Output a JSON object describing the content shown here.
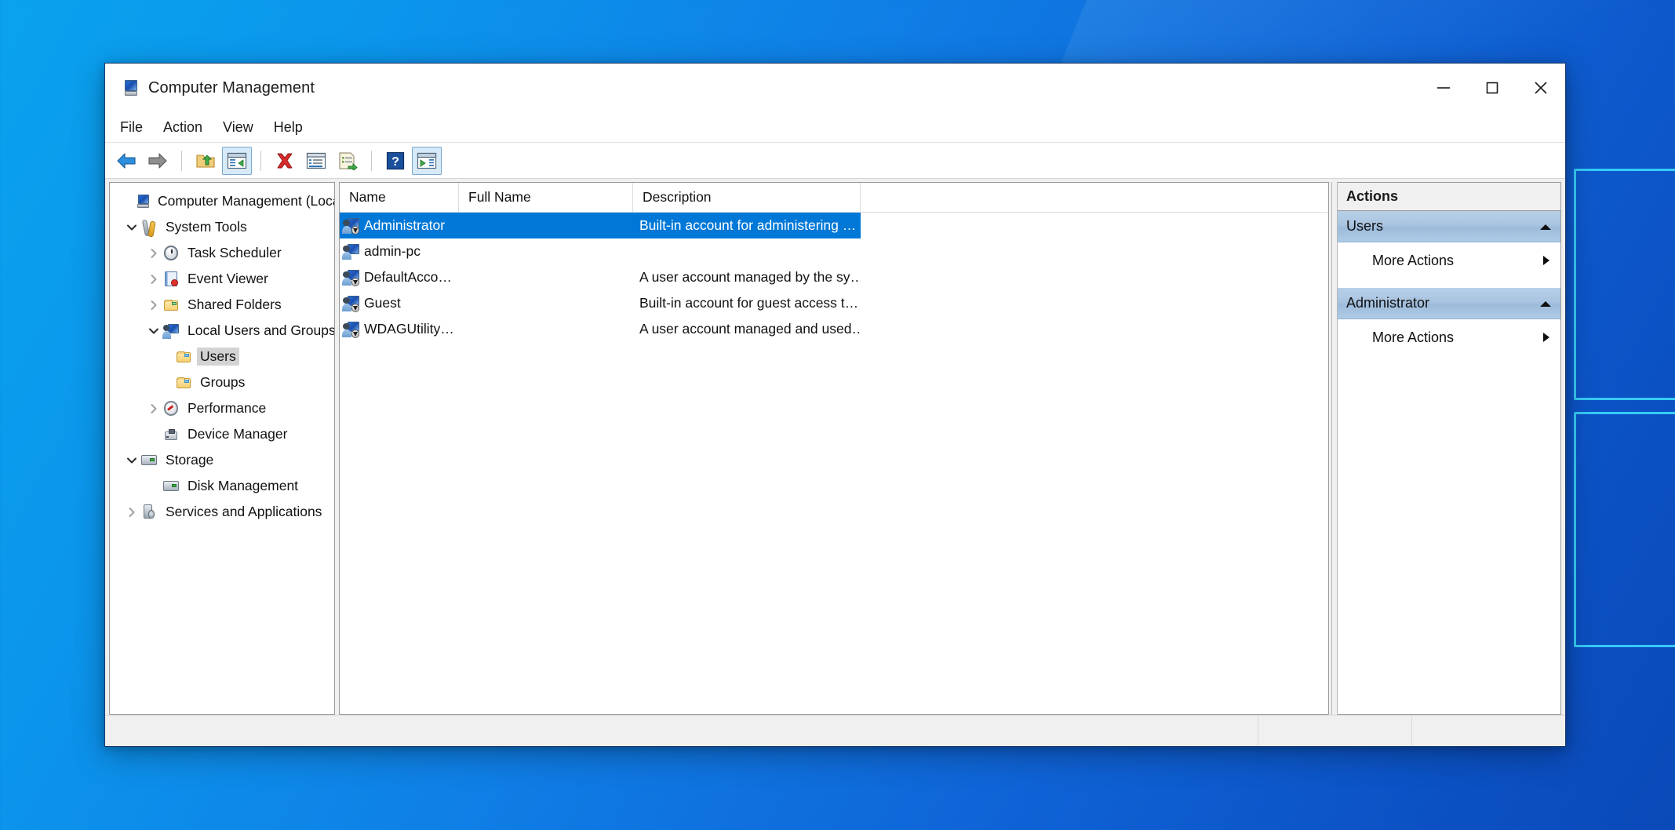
{
  "window": {
    "title": "Computer Management",
    "app_icon": "computer-management-icon",
    "controls": {
      "minimize": "minimize-icon",
      "maximize": "maximize-icon",
      "close": "close-icon"
    }
  },
  "menubar": {
    "items": [
      {
        "label": "File",
        "name": "menu-file"
      },
      {
        "label": "Action",
        "name": "menu-action"
      },
      {
        "label": "View",
        "name": "menu-view"
      },
      {
        "label": "Help",
        "name": "menu-help"
      }
    ]
  },
  "toolbar": {
    "buttons": [
      {
        "name": "back-button",
        "icon": "back-arrow-icon",
        "active": false
      },
      {
        "name": "forward-button",
        "icon": "forward-arrow-icon",
        "active": false
      },
      {
        "name": "up-one-level-button",
        "icon": "folder-up-icon",
        "active": false
      },
      {
        "name": "show-hide-console-tree-button",
        "icon": "console-tree-icon",
        "active": true
      },
      {
        "name": "delete-button",
        "icon": "delete-x-icon",
        "active": false
      },
      {
        "name": "properties-button",
        "icon": "properties-icon",
        "active": false
      },
      {
        "name": "export-list-button",
        "icon": "export-list-icon",
        "active": false
      },
      {
        "name": "help-button",
        "icon": "help-question-icon",
        "active": false
      },
      {
        "name": "show-hide-action-pane-button",
        "icon": "action-pane-icon",
        "active": true
      }
    ]
  },
  "tree": {
    "items": [
      {
        "label": "Computer Management (Local)",
        "icon": "computer-icon",
        "indent": 0,
        "twisty": "none",
        "selected": false,
        "name": "tree-item-computer-management-local"
      },
      {
        "label": "System Tools",
        "icon": "tools-icon",
        "indent": 1,
        "twisty": "expanded",
        "selected": false,
        "name": "tree-item-system-tools"
      },
      {
        "label": "Task Scheduler",
        "icon": "clock-icon",
        "indent": 2,
        "twisty": "collapsed",
        "selected": false,
        "name": "tree-item-task-scheduler"
      },
      {
        "label": "Event Viewer",
        "icon": "event-log-icon",
        "indent": 2,
        "twisty": "collapsed",
        "selected": false,
        "name": "tree-item-event-viewer"
      },
      {
        "label": "Shared Folders",
        "icon": "shared-folder-icon",
        "indent": 2,
        "twisty": "collapsed",
        "selected": false,
        "name": "tree-item-shared-folders"
      },
      {
        "label": "Local Users and Groups",
        "icon": "users-computer-icon",
        "indent": 2,
        "twisty": "expanded",
        "selected": false,
        "name": "tree-item-local-users-and-groups"
      },
      {
        "label": "Users",
        "icon": "folder-icon",
        "indent": 3,
        "twisty": "none",
        "selected": true,
        "name": "tree-item-users"
      },
      {
        "label": "Groups",
        "icon": "folder-icon",
        "indent": 3,
        "twisty": "none",
        "selected": false,
        "name": "tree-item-groups"
      },
      {
        "label": "Performance",
        "icon": "gauge-icon",
        "indent": 2,
        "twisty": "collapsed",
        "selected": false,
        "name": "tree-item-performance"
      },
      {
        "label": "Device Manager",
        "icon": "device-icon",
        "indent": 2,
        "twisty": "none",
        "selected": false,
        "name": "tree-item-device-manager"
      },
      {
        "label": "Storage",
        "icon": "storage-icon",
        "indent": 1,
        "twisty": "expanded",
        "selected": false,
        "name": "tree-item-storage"
      },
      {
        "label": "Disk Management",
        "icon": "disk-icon",
        "indent": 2,
        "twisty": "none",
        "selected": false,
        "name": "tree-item-disk-management"
      },
      {
        "label": "Services and Applications",
        "icon": "services-icon",
        "indent": 1,
        "twisty": "collapsed",
        "selected": false,
        "name": "tree-item-services-and-applications"
      }
    ]
  },
  "list": {
    "columns": [
      {
        "label": "Name",
        "name": "column-header-name"
      },
      {
        "label": "Full Name",
        "name": "column-header-full-name"
      },
      {
        "label": "Description",
        "name": "column-header-description"
      }
    ],
    "rows": [
      {
        "name": "Administrator",
        "full_name": "",
        "description": "Built-in account for administering …",
        "icon": "user-disabled-icon",
        "selected": true
      },
      {
        "name": "admin-pc",
        "full_name": "",
        "description": "",
        "icon": "user-icon",
        "selected": false
      },
      {
        "name": "DefaultAcco…",
        "full_name": "",
        "description": "A user account managed by the sy…",
        "icon": "user-disabled-icon",
        "selected": false
      },
      {
        "name": "Guest",
        "full_name": "",
        "description": "Built-in account for guest access t…",
        "icon": "user-disabled-icon",
        "selected": false
      },
      {
        "name": "WDAGUtility…",
        "full_name": "",
        "description": "A user account managed and used…",
        "icon": "user-disabled-icon",
        "selected": false
      }
    ]
  },
  "actions": {
    "title": "Actions",
    "sections": [
      {
        "label": "Users",
        "name": "actions-section-users",
        "collapse_icon": "chevron-up-icon",
        "items": [
          {
            "label": "More Actions",
            "name": "more-actions-users",
            "submenu_icon": "chevron-right-icon"
          }
        ]
      },
      {
        "label": "Administrator",
        "name": "actions-section-administrator",
        "collapse_icon": "chevron-up-icon",
        "items": [
          {
            "label": "More Actions",
            "name": "more-actions-administrator",
            "submenu_icon": "chevron-right-icon"
          }
        ]
      }
    ]
  },
  "statusbar": {
    "text": "",
    "segments": [
      "",
      ""
    ]
  },
  "colors": {
    "selection_blue": "#0078d7",
    "actions_section_blue": "#a9c4e0",
    "tree_selection_gray": "#d3d3d3",
    "desktop_blue": "#0f7fe6",
    "accent_cyan": "#40e0ff"
  }
}
